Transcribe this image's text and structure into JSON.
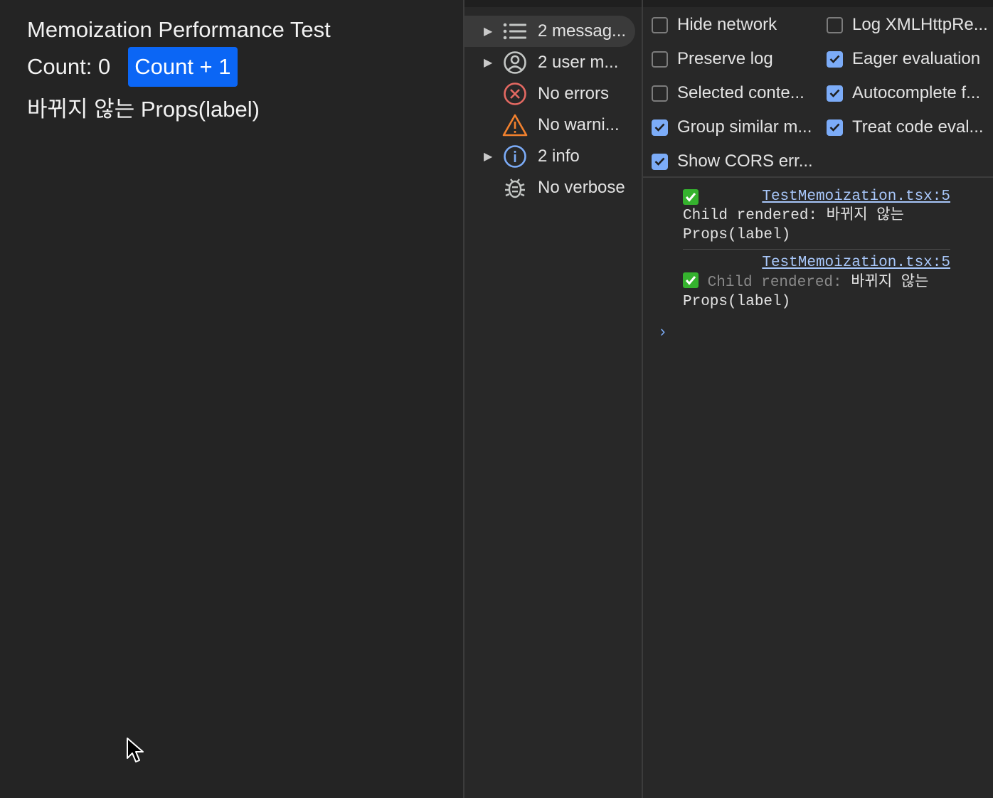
{
  "app": {
    "title": "Memoization Performance Test",
    "count_text": "Count: 0",
    "count_button": "Count + 1",
    "child_label": "바뀌지 않는 Props(label)"
  },
  "sidebar": {
    "items": [
      {
        "label": "2 messag...",
        "icon": "list-icon",
        "expandable": true,
        "selected": true
      },
      {
        "label": "2 user m...",
        "icon": "user-icon",
        "expandable": true,
        "selected": false
      },
      {
        "label": "No errors",
        "icon": "error-icon",
        "expandable": false,
        "selected": false
      },
      {
        "label": "No warni...",
        "icon": "warning-icon",
        "expandable": false,
        "selected": false
      },
      {
        "label": "2 info",
        "icon": "info-icon",
        "expandable": true,
        "selected": false
      },
      {
        "label": "No verbose",
        "icon": "bug-icon",
        "expandable": false,
        "selected": false
      }
    ]
  },
  "settings": [
    {
      "label": "Hide network",
      "checked": false
    },
    {
      "label": "Log XMLHttpRe...",
      "checked": false
    },
    {
      "label": "Preserve log",
      "checked": false
    },
    {
      "label": "Eager evaluation",
      "checked": true
    },
    {
      "label": "Selected conte...",
      "checked": false
    },
    {
      "label": "Autocomplete f...",
      "checked": true
    },
    {
      "label": "Group similar m...",
      "checked": true
    },
    {
      "label": "Treat code eval...",
      "checked": true
    },
    {
      "label": "Show CORS err...",
      "checked": true
    }
  ],
  "console": {
    "messages": [
      {
        "source": "TestMemoization.tsx:5",
        "prefix": "Child rendered:",
        "text": "바뀌지 않는",
        "text2": "Props(label)"
      },
      {
        "source": "TestMemoization.tsx:5",
        "prefix": "Child rendered:",
        "text": "바뀌지 않는",
        "text2": "Props(label)"
      }
    ],
    "prompt_symbol": "›"
  },
  "colors": {
    "accent_button": "#0b66f5",
    "checkbox_checked": "#7cacf8",
    "link": "#a8c7fa"
  }
}
